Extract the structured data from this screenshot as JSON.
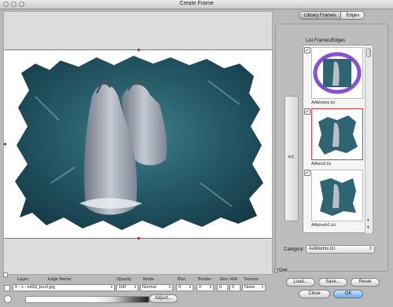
{
  "window": {
    "title": "Create Frame"
  },
  "tabs": [
    {
      "label": "Library Frames",
      "active": true
    },
    {
      "label": "Edges",
      "active": false
    }
  ],
  "library": {
    "list_label": "List Frames/Edges",
    "collapse_label": "<<",
    "items": [
      {
        "label": "AAblumix.tci",
        "checked": true,
        "selected": false
      },
      {
        "label": "AAbru3.tci",
        "checked": true,
        "selected": true
      },
      {
        "label": "AAbrush1.tci",
        "checked": true,
        "selected": false
      }
    ],
    "category_label": "Category:",
    "category_value": "AAblumix.tci"
  },
  "qual": {
    "label": "Qual",
    "checked": true
  },
  "buttons": {
    "load": "Load...",
    "save": "Save...",
    "reset": "Reset",
    "close": "Close",
    "ok": "OK",
    "adjust": "Adjust..."
  },
  "controls": {
    "layer_label": "Layer:",
    "edge_name_label": "Edge Name:",
    "opacity_label": "Opacity:",
    "mode_label": "Mode",
    "blur_label": "Blur:",
    "border_label": "Border:",
    "revhv_label": "Rev. H/A:",
    "texture_label": "Texture:",
    "layer_value": "0 - x - ed2d_bru3.jpg",
    "opacity_value": "100",
    "mode_value": "Normal",
    "blur_value": "0",
    "border_value": "0",
    "revh_value": "0",
    "reva_value": "0",
    "texture_value": "None"
  },
  "colors": {
    "guide_red": "#e84545",
    "selection_red": "#d93b3b",
    "ok_blue": "#6da9e5"
  }
}
